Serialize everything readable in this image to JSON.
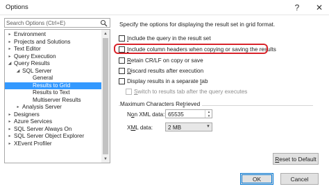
{
  "window": {
    "title": "Options",
    "help_glyph": "?",
    "close_glyph": "✕"
  },
  "search": {
    "placeholder": "Search Options (Ctrl+E)"
  },
  "tree": {
    "items": [
      {
        "label": "Environment",
        "expander": "▸",
        "selected": false
      },
      {
        "label": "Projects and Solutions",
        "expander": "▸",
        "selected": false
      },
      {
        "label": "Text Editor",
        "expander": "▸",
        "selected": false
      },
      {
        "label": "Query Execution",
        "expander": "▸",
        "selected": false
      },
      {
        "label": "Query Results",
        "expander": "◢",
        "selected": false
      },
      {
        "label": "SQL Server",
        "expander": "◢",
        "selected": false
      },
      {
        "label": "General",
        "expander": "",
        "selected": false
      },
      {
        "label": "Results to Grid",
        "expander": "",
        "selected": true
      },
      {
        "label": "Results to Text",
        "expander": "",
        "selected": false
      },
      {
        "label": "Multiserver Results",
        "expander": "",
        "selected": false
      },
      {
        "label": "Analysis Server",
        "expander": "▸",
        "selected": false
      },
      {
        "label": "Designers",
        "expander": "▸",
        "selected": false
      },
      {
        "label": "Azure Services",
        "expander": "▸",
        "selected": false
      },
      {
        "label": "SQL Server Always On",
        "expander": "▸",
        "selected": false
      },
      {
        "label": "SQL Server Object Explorer",
        "expander": "▸",
        "selected": false
      },
      {
        "label": "XEvent Profiler",
        "expander": "▸",
        "selected": false
      }
    ],
    "scroll_up": "▲",
    "scroll_down": "▼"
  },
  "panel": {
    "description": "Specify the options for displaying the result set in grid format.",
    "options": [
      {
        "pre": "",
        "key": "I",
        "post": "nclude the query in the result set",
        "checked": false,
        "enabled": true
      },
      {
        "pre": "",
        "key": "I",
        "post": "nclude column headers when copying or saving the results",
        "checked": false,
        "enabled": true
      },
      {
        "pre": "",
        "key": "R",
        "post": "etain CR/LF on copy or save",
        "checked": false,
        "enabled": true
      },
      {
        "pre": "",
        "key": "D",
        "post": "iscard results after execution",
        "checked": false,
        "enabled": true
      },
      {
        "pre": "Display results in a separate ",
        "key": "t",
        "post": "ab",
        "checked": false,
        "enabled": true
      },
      {
        "pre": "",
        "key": "S",
        "post": "witch to results tab after the query executes",
        "checked": false,
        "enabled": false
      }
    ],
    "max_chars": {
      "title_pre": "Maximum Characters Re",
      "title_key": "t",
      "title_post": "rieved",
      "non_xml": {
        "label_pre": "N",
        "label_key": "o",
        "label_post": "n XML data:",
        "value": "65535"
      },
      "xml": {
        "label_pre": "X",
        "label_key": "M",
        "label_post": "L data:",
        "value": "2 MB"
      }
    },
    "reset_pre": "",
    "reset_key": "R",
    "reset_post": "eset to Default"
  },
  "footer": {
    "ok_label": "OK",
    "cancel_label": "Cancel"
  },
  "colors": {
    "selection": "#3399ff",
    "highlight_ring": "#d8232a",
    "ok_border": "#0078d7"
  }
}
